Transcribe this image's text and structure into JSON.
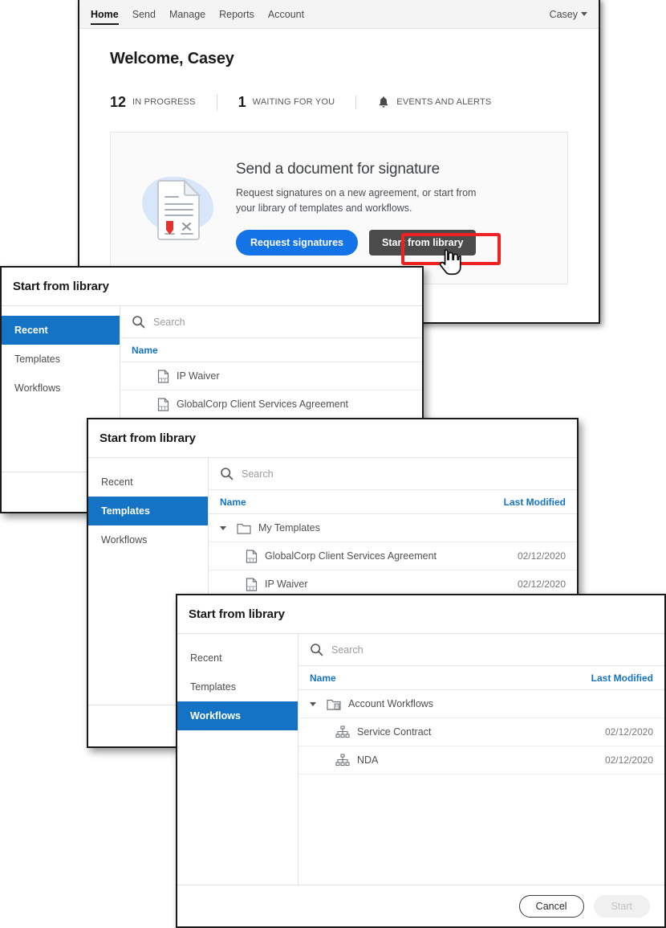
{
  "app": {
    "nav": [
      {
        "label": "Home",
        "active": true
      },
      {
        "label": "Send",
        "active": false
      },
      {
        "label": "Manage",
        "active": false
      },
      {
        "label": "Reports",
        "active": false
      },
      {
        "label": "Account",
        "active": false
      }
    ],
    "user_menu": "Casey",
    "welcome": "Welcome, Casey",
    "stats": [
      {
        "num": "12",
        "label": "IN PROGRESS"
      },
      {
        "num": "1",
        "label": "WAITING FOR YOU"
      },
      {
        "num": "",
        "label": "EVENTS AND ALERTS"
      }
    ],
    "promo": {
      "title": "Send a document for signature",
      "subtitle": "Request signatures on a new agreement, or start from your library of templates and workflows.",
      "primary_label": "Request signatures",
      "secondary_label": "Start from library"
    },
    "accent_blue": "#1473e6",
    "highlight_red": "#ee2222"
  },
  "dialogs": {
    "recent": {
      "title": "Start from library",
      "sidebar": [
        {
          "label": "Recent",
          "selected": true
        },
        {
          "label": "Templates",
          "selected": false
        },
        {
          "label": "Workflows",
          "selected": false
        }
      ],
      "search_placeholder": "Search",
      "columns": {
        "name": "Name",
        "modified": ""
      },
      "rows": [
        {
          "name": "IP Waiver",
          "icon": "document-icon",
          "date": "",
          "indent": 1
        },
        {
          "name": "GlobalCorp Client Services Agreement",
          "icon": "document-icon",
          "date": "",
          "indent": 1
        }
      ]
    },
    "templates": {
      "title": "Start from library",
      "sidebar": [
        {
          "label": "Recent",
          "selected": false
        },
        {
          "label": "Templates",
          "selected": true
        },
        {
          "label": "Workflows",
          "selected": false
        }
      ],
      "search_placeholder": "Search",
      "columns": {
        "name": "Name",
        "modified": "Last Modified"
      },
      "rows": [
        {
          "name": "My Templates",
          "icon": "folder-icon",
          "date": "",
          "indent": 0,
          "expanded": true
        },
        {
          "name": "GlobalCorp Client Services Agreement",
          "icon": "document-icon",
          "date": "02/12/2020",
          "indent": 1
        },
        {
          "name": "IP Waiver",
          "icon": "document-icon",
          "date": "02/12/2020",
          "indent": 1
        }
      ]
    },
    "workflows": {
      "title": "Start from library",
      "sidebar": [
        {
          "label": "Recent",
          "selected": false
        },
        {
          "label": "Templates",
          "selected": false
        },
        {
          "label": "Workflows",
          "selected": true
        }
      ],
      "search_placeholder": "Search",
      "columns": {
        "name": "Name",
        "modified": "Last Modified"
      },
      "rows": [
        {
          "name": "Account Workflows",
          "icon": "folder-account-icon",
          "date": "",
          "indent": 0,
          "expanded": true
        },
        {
          "name": "Service Contract",
          "icon": "workflow-icon",
          "date": "02/12/2020",
          "indent": 1
        },
        {
          "name": "NDA",
          "icon": "workflow-icon",
          "date": "02/12/2020",
          "indent": 1
        }
      ],
      "footer": {
        "cancel_label": "Cancel",
        "start_label": "Start"
      }
    }
  }
}
